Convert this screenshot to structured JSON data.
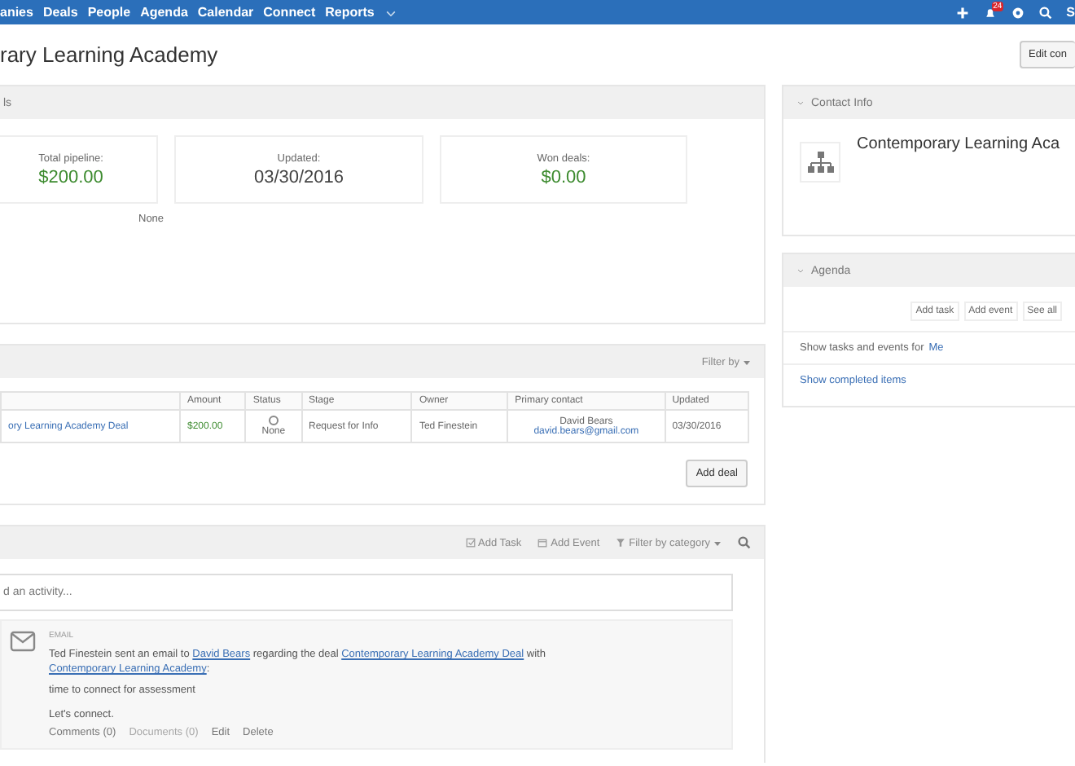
{
  "nav": {
    "items": [
      "anies",
      "Deals",
      "People",
      "Agenda",
      "Calendar",
      "Connect",
      "Reports"
    ],
    "badge": "24",
    "cut_label": "S"
  },
  "page": {
    "title": "rary Learning Academy",
    "edit_button": "Edit con"
  },
  "summary": {
    "header": "ls",
    "cards": [
      {
        "label": "Total pipeline:",
        "value": "$200.00",
        "kind": "money"
      },
      {
        "label": "Updated:",
        "value": "03/30/2016",
        "kind": "plain"
      },
      {
        "label": "Won deals:",
        "value": "$0.00",
        "kind": "money"
      }
    ],
    "note": "None"
  },
  "deals": {
    "filter": "Filter by",
    "columns": [
      "",
      "Amount",
      "Status",
      "Stage",
      "Owner",
      "Primary contact",
      "Updated"
    ],
    "rows": [
      {
        "name": "ory Learning Academy Deal",
        "amount": "$200.00",
        "status": "None",
        "checked": false,
        "stage": "Request for Info",
        "owner": "Ted Finestein",
        "contact_name": "David Bears",
        "contact_email": "david.bears@gmail.com",
        "updated": "03/30/2016"
      }
    ],
    "add_button": "Add deal"
  },
  "activity": {
    "tools": [
      "Add Task",
      "Add Event",
      "Filter by category"
    ],
    "placeholder": "d an activity...",
    "items": [
      {
        "type": "EMAIL",
        "text": [
          {
            "t": "Ted Finestein sent an email to ",
            "link": false
          },
          {
            "t": "David Bears",
            "link": true
          },
          {
            "t": " regarding the deal ",
            "link": false
          },
          {
            "t": "Contemporary Learning Academy Deal",
            "link": true
          },
          {
            "t": " with ",
            "link": false
          },
          {
            "t": "Contemporary Learning Academy",
            "link": true
          },
          {
            "t": ":",
            "link": false
          }
        ],
        "subject": "time to connect for assessment",
        "body": "Let's connect.",
        "actions": [
          {
            "label": "Comments (0)",
            "disabled": false
          },
          {
            "label": "Documents (0)",
            "disabled": true
          },
          {
            "label": "Edit",
            "disabled": false
          },
          {
            "label": "Delete",
            "disabled": false
          }
        ]
      }
    ]
  },
  "contact_info": {
    "header": "Contact Info",
    "name": "Contemporary Learning Aca"
  },
  "agenda": {
    "header": "Agenda",
    "buttons": [
      "Add task",
      "Add event",
      "See all"
    ],
    "show_for": "Show tasks and events for",
    "who": "Me",
    "completed": "Show completed items"
  }
}
